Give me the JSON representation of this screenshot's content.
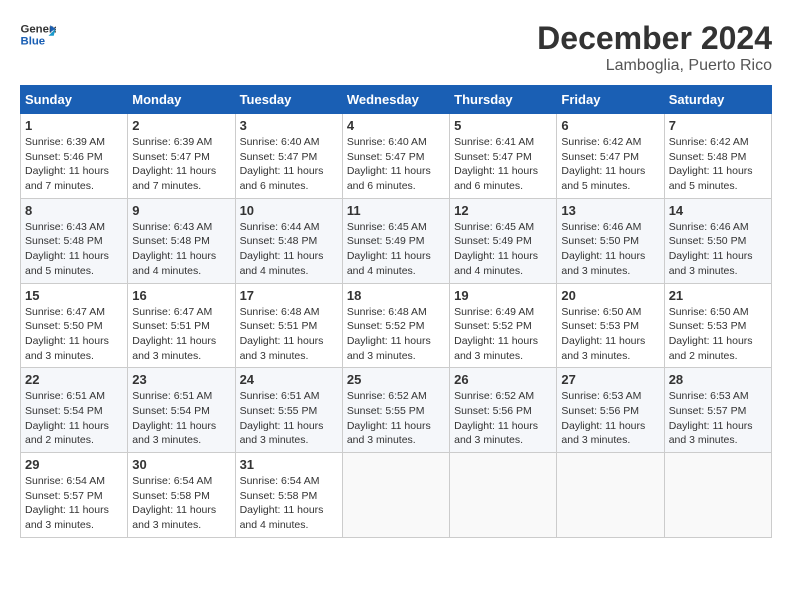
{
  "header": {
    "logo_general": "General",
    "logo_blue": "Blue",
    "month": "December 2024",
    "location": "Lamboglia, Puerto Rico"
  },
  "days_of_week": [
    "Sunday",
    "Monday",
    "Tuesday",
    "Wednesday",
    "Thursday",
    "Friday",
    "Saturday"
  ],
  "weeks": [
    [
      {
        "day": "1",
        "sunrise": "6:39 AM",
        "sunset": "5:46 PM",
        "daylight": "11 hours and 7 minutes."
      },
      {
        "day": "2",
        "sunrise": "6:39 AM",
        "sunset": "5:47 PM",
        "daylight": "11 hours and 7 minutes."
      },
      {
        "day": "3",
        "sunrise": "6:40 AM",
        "sunset": "5:47 PM",
        "daylight": "11 hours and 6 minutes."
      },
      {
        "day": "4",
        "sunrise": "6:40 AM",
        "sunset": "5:47 PM",
        "daylight": "11 hours and 6 minutes."
      },
      {
        "day": "5",
        "sunrise": "6:41 AM",
        "sunset": "5:47 PM",
        "daylight": "11 hours and 6 minutes."
      },
      {
        "day": "6",
        "sunrise": "6:42 AM",
        "sunset": "5:47 PM",
        "daylight": "11 hours and 5 minutes."
      },
      {
        "day": "7",
        "sunrise": "6:42 AM",
        "sunset": "5:48 PM",
        "daylight": "11 hours and 5 minutes."
      }
    ],
    [
      {
        "day": "8",
        "sunrise": "6:43 AM",
        "sunset": "5:48 PM",
        "daylight": "11 hours and 5 minutes."
      },
      {
        "day": "9",
        "sunrise": "6:43 AM",
        "sunset": "5:48 PM",
        "daylight": "11 hours and 4 minutes."
      },
      {
        "day": "10",
        "sunrise": "6:44 AM",
        "sunset": "5:48 PM",
        "daylight": "11 hours and 4 minutes."
      },
      {
        "day": "11",
        "sunrise": "6:45 AM",
        "sunset": "5:49 PM",
        "daylight": "11 hours and 4 minutes."
      },
      {
        "day": "12",
        "sunrise": "6:45 AM",
        "sunset": "5:49 PM",
        "daylight": "11 hours and 4 minutes."
      },
      {
        "day": "13",
        "sunrise": "6:46 AM",
        "sunset": "5:50 PM",
        "daylight": "11 hours and 3 minutes."
      },
      {
        "day": "14",
        "sunrise": "6:46 AM",
        "sunset": "5:50 PM",
        "daylight": "11 hours and 3 minutes."
      }
    ],
    [
      {
        "day": "15",
        "sunrise": "6:47 AM",
        "sunset": "5:50 PM",
        "daylight": "11 hours and 3 minutes."
      },
      {
        "day": "16",
        "sunrise": "6:47 AM",
        "sunset": "5:51 PM",
        "daylight": "11 hours and 3 minutes."
      },
      {
        "day": "17",
        "sunrise": "6:48 AM",
        "sunset": "5:51 PM",
        "daylight": "11 hours and 3 minutes."
      },
      {
        "day": "18",
        "sunrise": "6:48 AM",
        "sunset": "5:52 PM",
        "daylight": "11 hours and 3 minutes."
      },
      {
        "day": "19",
        "sunrise": "6:49 AM",
        "sunset": "5:52 PM",
        "daylight": "11 hours and 3 minutes."
      },
      {
        "day": "20",
        "sunrise": "6:50 AM",
        "sunset": "5:53 PM",
        "daylight": "11 hours and 3 minutes."
      },
      {
        "day": "21",
        "sunrise": "6:50 AM",
        "sunset": "5:53 PM",
        "daylight": "11 hours and 2 minutes."
      }
    ],
    [
      {
        "day": "22",
        "sunrise": "6:51 AM",
        "sunset": "5:54 PM",
        "daylight": "11 hours and 2 minutes."
      },
      {
        "day": "23",
        "sunrise": "6:51 AM",
        "sunset": "5:54 PM",
        "daylight": "11 hours and 3 minutes."
      },
      {
        "day": "24",
        "sunrise": "6:51 AM",
        "sunset": "5:55 PM",
        "daylight": "11 hours and 3 minutes."
      },
      {
        "day": "25",
        "sunrise": "6:52 AM",
        "sunset": "5:55 PM",
        "daylight": "11 hours and 3 minutes."
      },
      {
        "day": "26",
        "sunrise": "6:52 AM",
        "sunset": "5:56 PM",
        "daylight": "11 hours and 3 minutes."
      },
      {
        "day": "27",
        "sunrise": "6:53 AM",
        "sunset": "5:56 PM",
        "daylight": "11 hours and 3 minutes."
      },
      {
        "day": "28",
        "sunrise": "6:53 AM",
        "sunset": "5:57 PM",
        "daylight": "11 hours and 3 minutes."
      }
    ],
    [
      {
        "day": "29",
        "sunrise": "6:54 AM",
        "sunset": "5:57 PM",
        "daylight": "11 hours and 3 minutes."
      },
      {
        "day": "30",
        "sunrise": "6:54 AM",
        "sunset": "5:58 PM",
        "daylight": "11 hours and 3 minutes."
      },
      {
        "day": "31",
        "sunrise": "6:54 AM",
        "sunset": "5:58 PM",
        "daylight": "11 hours and 4 minutes."
      },
      null,
      null,
      null,
      null
    ]
  ],
  "labels": {
    "sunrise": "Sunrise:",
    "sunset": "Sunset:",
    "daylight": "Daylight:"
  }
}
